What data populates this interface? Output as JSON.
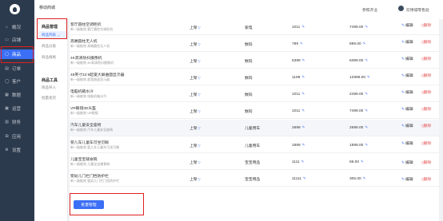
{
  "header": {
    "title": "移动商城",
    "help": "参照开业",
    "user": "欢博城零售处"
  },
  "sidebar": {
    "items": [
      {
        "label": "概况",
        "icon": "home-icon"
      },
      {
        "label": "店铺",
        "icon": "shop-icon"
      },
      {
        "label": "商品",
        "icon": "bag-icon"
      },
      {
        "label": "订单",
        "icon": "order-icon"
      },
      {
        "label": "客户",
        "icon": "user-icon"
      },
      {
        "label": "数据",
        "icon": "chart-icon"
      },
      {
        "label": "运营",
        "icon": "gift-icon"
      },
      {
        "label": "财务",
        "icon": "wallet-icon"
      },
      {
        "label": "应用",
        "icon": "apps-icon"
      },
      {
        "label": "设置",
        "icon": "gear-icon"
      }
    ]
  },
  "submenu": {
    "group1": "商品管理",
    "group1_items": [
      "商品列表",
      "商品分类",
      "商品规格"
    ],
    "group2": "商品工具",
    "group2_items": [
      "商品导入",
      "批量发货"
    ]
  },
  "table": {
    "rows": [
      {
        "name": "客厅圆柱空调柜机",
        "sub": "新一级能效 客厅圆柱空调柜机",
        "status": "上架",
        "category": "家电",
        "stock": "1011",
        "price": "7499.00",
        "edit": "编辑",
        "del": "删除"
      },
      {
        "name": "高端圆柱无人机",
        "sub": "新一级能效 高端圆柱无人机",
        "status": "上架",
        "category": "数码",
        "stock": "789",
        "price": "899.00",
        "edit": "编辑",
        "del": "删除"
      },
      {
        "name": "4K高清防抖摄像机",
        "sub": "新一级能效 4K高清防抖摄像机",
        "status": "上架",
        "category": "数码",
        "stock": "5399",
        "price": "6399.00",
        "edit": "编辑",
        "del": "删除"
      },
      {
        "name": "49英寸32:9超宽大屏曲面显示器",
        "sub": "新一级能效 超宽曲面显示器",
        "status": "上架",
        "category": "数码",
        "stock": "1199",
        "price": "12999.00",
        "edit": "编辑",
        "del": "删除"
      },
      {
        "name": "电脑机箱水冷",
        "sub": "新一级能效 电脑机箱水冷",
        "status": "上架",
        "category": "数码",
        "stock": "1011",
        "price": "2499.00",
        "edit": "编辑",
        "del": "删除"
      },
      {
        "name": "VR眼镜3D头盔",
        "sub": "新一级能效 VR眼镜",
        "status": "上架",
        "category": "数码",
        "stock": "1011",
        "price": "7499.00",
        "edit": "编辑",
        "del": "删除"
      },
      {
        "name": "汽车儿童安全座椅",
        "sub": "新一级能效 汽车儿童安全座椅",
        "status": "上架",
        "category": "儿童用车",
        "stock": "2699",
        "price": "2699.00",
        "edit": "编辑",
        "del": "删除"
      },
      {
        "name": "婴儿车儿童车可坐可躺",
        "sub": "新一级能效 婴儿车儿童车可坐可躺",
        "status": "上架",
        "category": "儿童用车",
        "stock": "1899",
        "price": "1899.00",
        "edit": "编辑",
        "del": "删除"
      },
      {
        "name": "儿童宝宝辅食碗",
        "sub": "新一级能效 儿童宝宝辅食碗",
        "status": "上架",
        "category": "宝宝用品",
        "stock": "1111",
        "price": "69.00",
        "edit": "编辑",
        "del": "删除"
      },
      {
        "name": "婴幼儿门栏门挡防护栏",
        "sub": "新一级能效 婴幼儿门栏门挡防护栏",
        "status": "上架",
        "category": "宝宝用品",
        "stock": "11111",
        "price": "305.00",
        "edit": "编辑",
        "del": "删除"
      }
    ]
  },
  "batch_button": "批量管理",
  "colors": {
    "accent": "#3b6ff5",
    "sidebar": "#2c3a4d",
    "highlight": "#e02020"
  }
}
